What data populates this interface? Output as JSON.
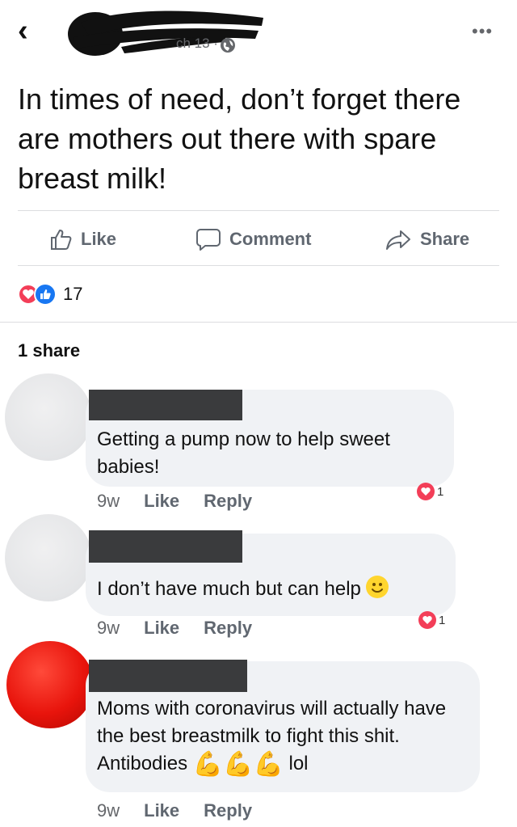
{
  "header": {
    "back_icon": "chevron-left-icon",
    "meta_text": "ch 13 ·",
    "privacy_icon": "globe-icon",
    "more_icon": "ellipsis-icon"
  },
  "post": {
    "text": "In times of need, don’t forget there are mothers out there with spare breast milk!"
  },
  "actions": {
    "like": "Like",
    "comment": "Comment",
    "share": "Share"
  },
  "reactions": {
    "count": "17",
    "types": [
      "heart",
      "like"
    ]
  },
  "shares": "1 share",
  "comments": [
    {
      "text": "Getting a pump now to help sweet babies!",
      "time": "9w",
      "like": "Like",
      "reply": "Reply",
      "reaction_count": "1"
    },
    {
      "text": "I don’t have much but can help",
      "time": "9w",
      "like": "Like",
      "reply": "Reply",
      "reaction_count": "1",
      "emoji": "slightly-smiling-face"
    },
    {
      "text_before": "Moms with coronavirus will actually have the best breastmilk to fight this shit. Antibodies",
      "text_after": "lol",
      "time": "9w",
      "like": "Like",
      "reply": "Reply",
      "emoji": "flexed-biceps x3"
    }
  ],
  "colors": {
    "reaction_red": "#f33e58",
    "like_blue": "#1877f2",
    "bubble_bg": "#f0f2f5",
    "secondary_text": "#65676b"
  }
}
